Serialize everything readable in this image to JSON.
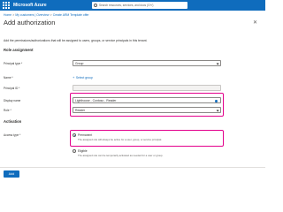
{
  "topbar": {
    "brand": "Microsoft Azure",
    "search_placeholder": "Search resources, services, and docs (G+/)"
  },
  "breadcrumb": {
    "items": [
      "Home",
      "My customers | Overview",
      "Create ARM Template offer"
    ]
  },
  "page": {
    "title": "Add authorization",
    "description": "Add the permissions/authorizations that will be assigned to users, groups, or service principals in this tenant."
  },
  "role_assignment": {
    "heading": "Role assignment",
    "principal_type": {
      "label": "Principal type *",
      "value": "Group"
    },
    "name": {
      "label": "Name *",
      "link": "Select group"
    },
    "principal_id": {
      "label": "Principal ID *",
      "value": ""
    },
    "display_name": {
      "label": "Display name",
      "value": "Lighthouse - Contoso - Reader"
    },
    "role": {
      "label": "Role *",
      "value": "Reader"
    }
  },
  "activation": {
    "heading": "Activation",
    "access_type_label": "Access type *",
    "options": [
      {
        "label": "Permanent",
        "description": "The assigned role will always be active for a user, group, or service principal.",
        "selected": true
      },
      {
        "label": "Eligible",
        "description": "The assigned role can be temporarily activated as needed for a user or group.",
        "selected": false
      }
    ]
  },
  "footer": {
    "add_label": "Add"
  },
  "colors": {
    "accent": "#0f6cbd",
    "highlight": "#e3008c"
  },
  "icons": [
    "waffle-menu-icon",
    "search-icon",
    "close-icon",
    "chevron-down-icon",
    "plus-icon",
    "info-icon"
  ]
}
